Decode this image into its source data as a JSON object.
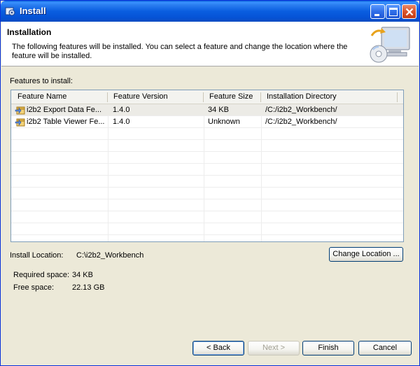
{
  "window": {
    "title": "Install"
  },
  "header": {
    "title": "Installation",
    "description": "The following features will be installed. You can select a feature and change the location where the feature will be installed."
  },
  "features_label": "Features to install:",
  "table": {
    "columns": [
      "Feature Name",
      "Feature Version",
      "Feature Size",
      "Installation Directory"
    ],
    "rows": [
      {
        "name": "i2b2 Export Data Fe...",
        "version": "1.4.0",
        "size": "34 KB",
        "directory": "/C:/i2b2_Workbench/",
        "selected": true
      },
      {
        "name": "i2b2 Table Viewer Fe...",
        "version": "1.4.0",
        "size": "Unknown",
        "directory": "/C:/i2b2_Workbench/",
        "selected": false
      }
    ]
  },
  "install_location": {
    "label": "Install Location:",
    "value": "C:\\i2b2_Workbench",
    "change_button": "Change Location ..."
  },
  "space": {
    "required_label": "Required space:",
    "required_value": "34 KB",
    "free_label": "Free space:",
    "free_value": "22.13 GB"
  },
  "buttons": {
    "back": "< Back",
    "next": "Next >",
    "finish": "Finish",
    "cancel": "Cancel"
  },
  "icons": {
    "app": "install-app-icon",
    "header": "monitor-cd-icon",
    "feature": "feature-package-icon"
  },
  "colors": {
    "titlebar": "#0a5ee0",
    "background": "#ece9d8",
    "selected_row": "#ecebe6"
  }
}
